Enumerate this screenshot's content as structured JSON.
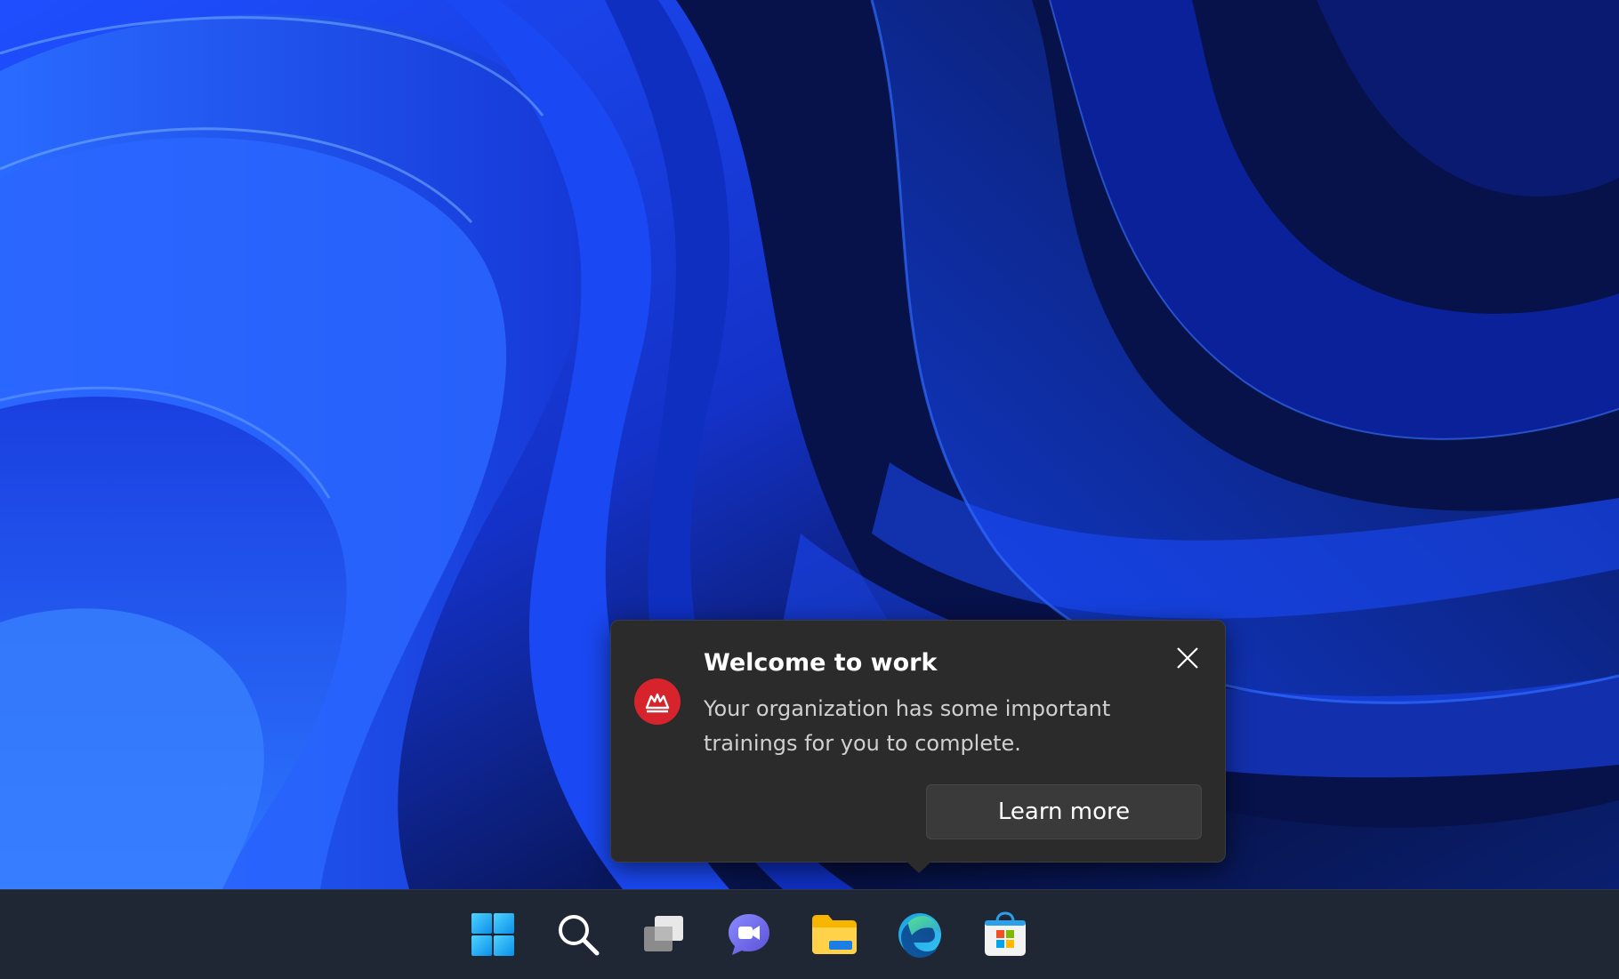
{
  "notification": {
    "title": "Welcome to work",
    "message": "Your organization has some important trainings for you to complete.",
    "action_label": "Learn more",
    "app_icon": "organization-training-icon",
    "close_icon": "close-icon"
  },
  "taskbar": {
    "items": [
      {
        "name": "Start",
        "icon": "windows-start-icon"
      },
      {
        "name": "Search",
        "icon": "search-icon"
      },
      {
        "name": "Task View",
        "icon": "task-view-icon"
      },
      {
        "name": "Chat",
        "icon": "chat-icon"
      },
      {
        "name": "File Explorer",
        "icon": "folder-icon"
      },
      {
        "name": "Microsoft Edge",
        "icon": "edge-icon"
      },
      {
        "name": "Microsoft Store",
        "icon": "store-icon"
      }
    ]
  },
  "colors": {
    "wallpaper_accent": "#1f5bff",
    "tip_background": "#2b2b2b",
    "taskbar_background": "#202734",
    "app_icon_red": "#d7242c"
  }
}
